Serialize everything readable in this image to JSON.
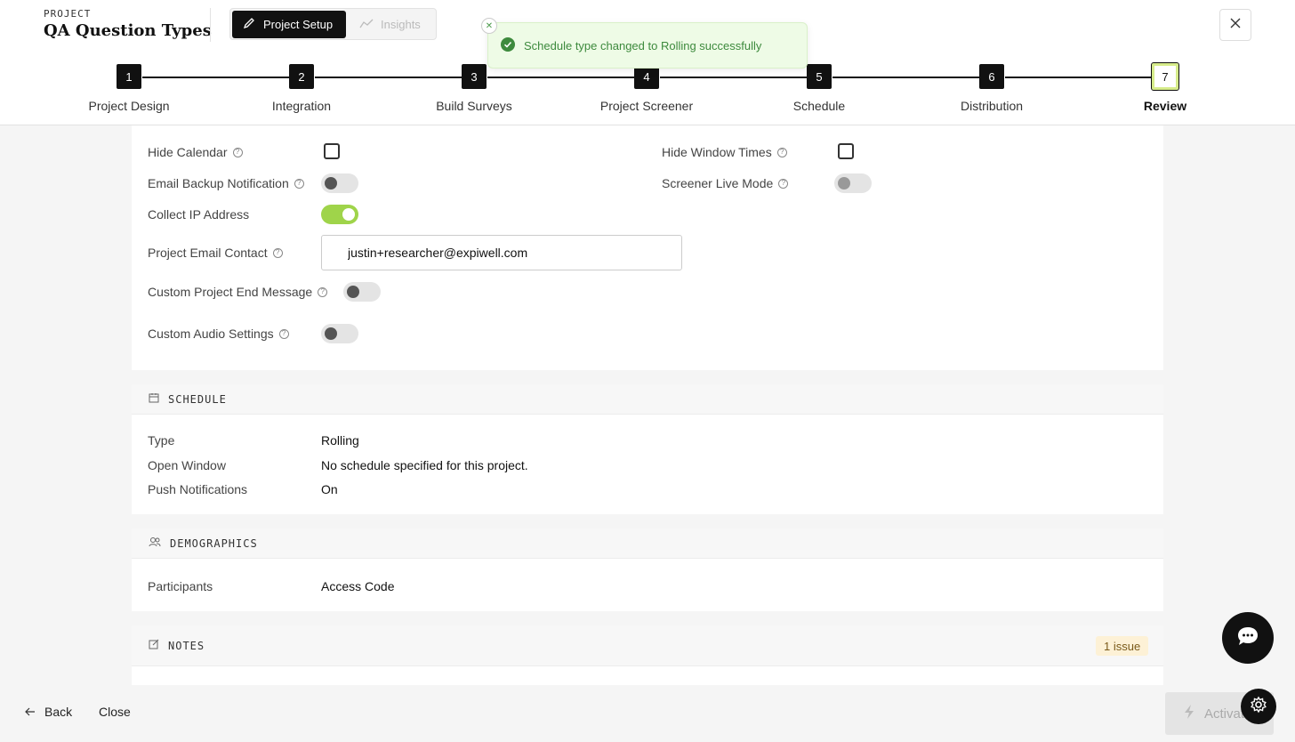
{
  "header": {
    "eyebrow": "PROJECT",
    "title": "QA Question Types",
    "tabs": {
      "setup": "Project Setup",
      "insights": "Insights"
    }
  },
  "toast": {
    "message": "Schedule type changed to Rolling successfully"
  },
  "steps": [
    {
      "number": "1",
      "label": "Project Design"
    },
    {
      "number": "2",
      "label": "Integration"
    },
    {
      "number": "3",
      "label": "Build Surveys"
    },
    {
      "number": "4",
      "label": "Project Screener"
    },
    {
      "number": "5",
      "label": "Schedule"
    },
    {
      "number": "6",
      "label": "Distribution"
    },
    {
      "number": "7",
      "label": "Review"
    }
  ],
  "settings": {
    "hide_calendar": {
      "label": "Hide Calendar",
      "checked": false
    },
    "hide_window_times": {
      "label": "Hide Window Times",
      "checked": false
    },
    "email_backup": {
      "label": "Email Backup Notification",
      "on": false
    },
    "screener_live": {
      "label": "Screener Live Mode",
      "on": false
    },
    "collect_ip": {
      "label": "Collect IP Address",
      "on": true
    },
    "email_contact": {
      "label": "Project Email Contact",
      "value": "justin+researcher@expiwell.com"
    },
    "custom_end": {
      "label": "Custom Project End Message",
      "on": false
    },
    "custom_audio": {
      "label": "Custom Audio Settings",
      "on": false
    }
  },
  "schedule": {
    "heading": "SCHEDULE",
    "rows": [
      {
        "label": "Type",
        "value": "Rolling"
      },
      {
        "label": "Open Window",
        "value": "No schedule specified for this project."
      },
      {
        "label": "Push Notifications",
        "value": "On"
      }
    ]
  },
  "demographics": {
    "heading": "DEMOGRAPHICS",
    "rows": [
      {
        "label": "Participants",
        "value": "Access Code"
      }
    ]
  },
  "notes": {
    "heading": "NOTES",
    "badge": "1 issue"
  },
  "footer": {
    "back": "Back",
    "close": "Close",
    "activate": "Activate"
  },
  "colors": {
    "accent": "#9fd44a",
    "toast_bg": "#eefbe6",
    "toast_text": "#3d8a3d",
    "dark": "#111111"
  }
}
